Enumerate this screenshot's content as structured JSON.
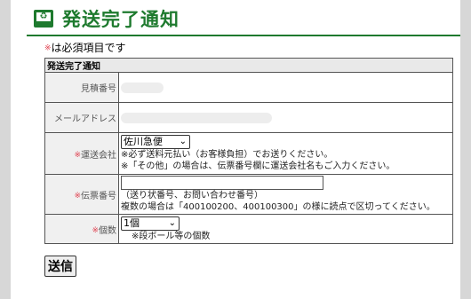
{
  "header": {
    "title": "発送完了通知",
    "icon": "recycle-monitor-icon",
    "icon_glyph": "♻",
    "accent_color": "#1e7a2e"
  },
  "required_note": {
    "marker": "※",
    "text": "は必須項目です"
  },
  "form": {
    "caption": "発送完了通知",
    "required_marker": "※",
    "rows": {
      "estimate": {
        "label": "見積番号"
      },
      "email": {
        "label": "メールアドレス"
      },
      "carrier": {
        "label": "運送会社",
        "selected": "佐川急便",
        "note1": "※必ず送料元払い（お客様負担）でお送りください。",
        "note2": "※「その他」の場合は、伝票番号欄に運送会社名もご入力ください。"
      },
      "tracking": {
        "label": "伝票番号",
        "value": "",
        "note1": "（送り状番号、お問い合わせ番号）",
        "note2": "複数の場合は「400100200、400100300」の様に読点で区切ってください。"
      },
      "quantity": {
        "label": "個数",
        "selected": "1個",
        "note": "※段ボール等の個数"
      }
    }
  },
  "submit_label": "送信"
}
